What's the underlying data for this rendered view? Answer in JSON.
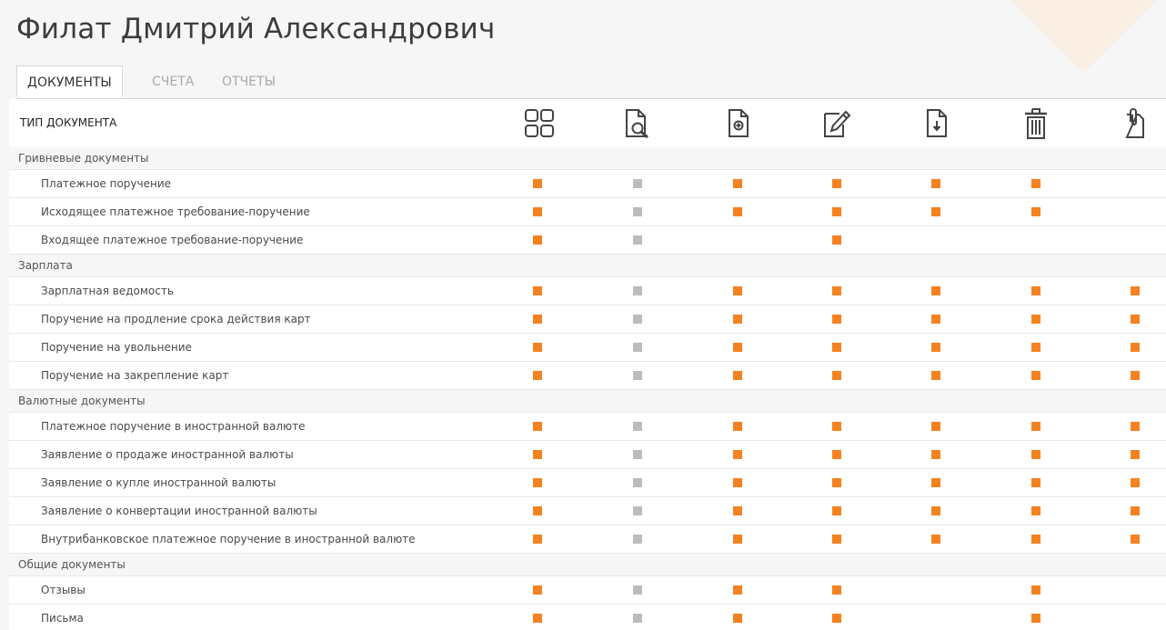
{
  "page": {
    "title": "Филат Дмитрий Александрович"
  },
  "tabs": [
    {
      "label": "ДОКУМЕНТЫ",
      "active": true
    },
    {
      "label": "СЧЕТА",
      "active": false
    },
    {
      "label": "ОТЧЕТЫ",
      "active": false
    }
  ],
  "table": {
    "header_label": "ТИП ДОКУМЕНТА",
    "columns": [
      {
        "icon": "grid-icon"
      },
      {
        "icon": "document-search-icon"
      },
      {
        "icon": "document-add-icon"
      },
      {
        "icon": "edit-document-icon"
      },
      {
        "icon": "document-download-icon"
      },
      {
        "icon": "trash-icon"
      },
      {
        "icon": "attachment-icon"
      }
    ],
    "colors": {
      "checked": "#f58220",
      "disabled": "#bcbcbc",
      "group_bg": "#f6f6f6"
    },
    "rows": [
      {
        "type": "group",
        "label": "Гривневые документы"
      },
      {
        "type": "item",
        "label": "Платежное поручение",
        "cells": [
          "on",
          "off",
          "on",
          "on",
          "on",
          "on",
          ""
        ]
      },
      {
        "type": "item",
        "label": "Исходящее платежное требование-поручение",
        "cells": [
          "on",
          "off",
          "on",
          "on",
          "on",
          "on",
          ""
        ]
      },
      {
        "type": "item",
        "label": "Входящее платежное требование-поручение",
        "cells": [
          "on",
          "off",
          "",
          "on",
          "",
          "",
          ""
        ]
      },
      {
        "type": "group",
        "label": "Зарплата"
      },
      {
        "type": "item",
        "label": "Зарплатная ведомость",
        "cells": [
          "on",
          "off",
          "on",
          "on",
          "on",
          "on",
          "on"
        ]
      },
      {
        "type": "item",
        "label": "Поручение на продление срока действия карт",
        "cells": [
          "on",
          "off",
          "on",
          "on",
          "on",
          "on",
          "on"
        ]
      },
      {
        "type": "item",
        "label": "Поручение на увольнение",
        "cells": [
          "on",
          "off",
          "on",
          "on",
          "on",
          "on",
          "on"
        ]
      },
      {
        "type": "item",
        "label": "Поручение на закрепление карт",
        "cells": [
          "on",
          "off",
          "on",
          "on",
          "on",
          "on",
          "on"
        ]
      },
      {
        "type": "group",
        "label": "Валютные документы"
      },
      {
        "type": "item",
        "label": "Платежное поручение в иностранной валюте",
        "cells": [
          "on",
          "off",
          "on",
          "on",
          "on",
          "on",
          "on"
        ]
      },
      {
        "type": "item",
        "label": "Заявление о продаже иностранной валюты",
        "cells": [
          "on",
          "off",
          "on",
          "on",
          "on",
          "on",
          "on"
        ]
      },
      {
        "type": "item",
        "label": "Заявление о купле иностранной валюты",
        "cells": [
          "on",
          "off",
          "on",
          "on",
          "on",
          "on",
          "on"
        ]
      },
      {
        "type": "item",
        "label": "Заявление о конвертации иностранной валюты",
        "cells": [
          "on",
          "off",
          "on",
          "on",
          "on",
          "on",
          "on"
        ]
      },
      {
        "type": "item",
        "label": "Внутрибанковское платежное поручение в иностранной валюте",
        "cells": [
          "on",
          "off",
          "on",
          "on",
          "on",
          "on",
          "on"
        ]
      },
      {
        "type": "group",
        "label": "Общие документы"
      },
      {
        "type": "item",
        "label": "Отзывы",
        "cells": [
          "on",
          "off",
          "on",
          "on",
          "",
          "on",
          ""
        ]
      },
      {
        "type": "item",
        "label": "Письма",
        "cells": [
          "on",
          "off",
          "on",
          "on",
          "",
          "on",
          ""
        ]
      }
    ]
  }
}
